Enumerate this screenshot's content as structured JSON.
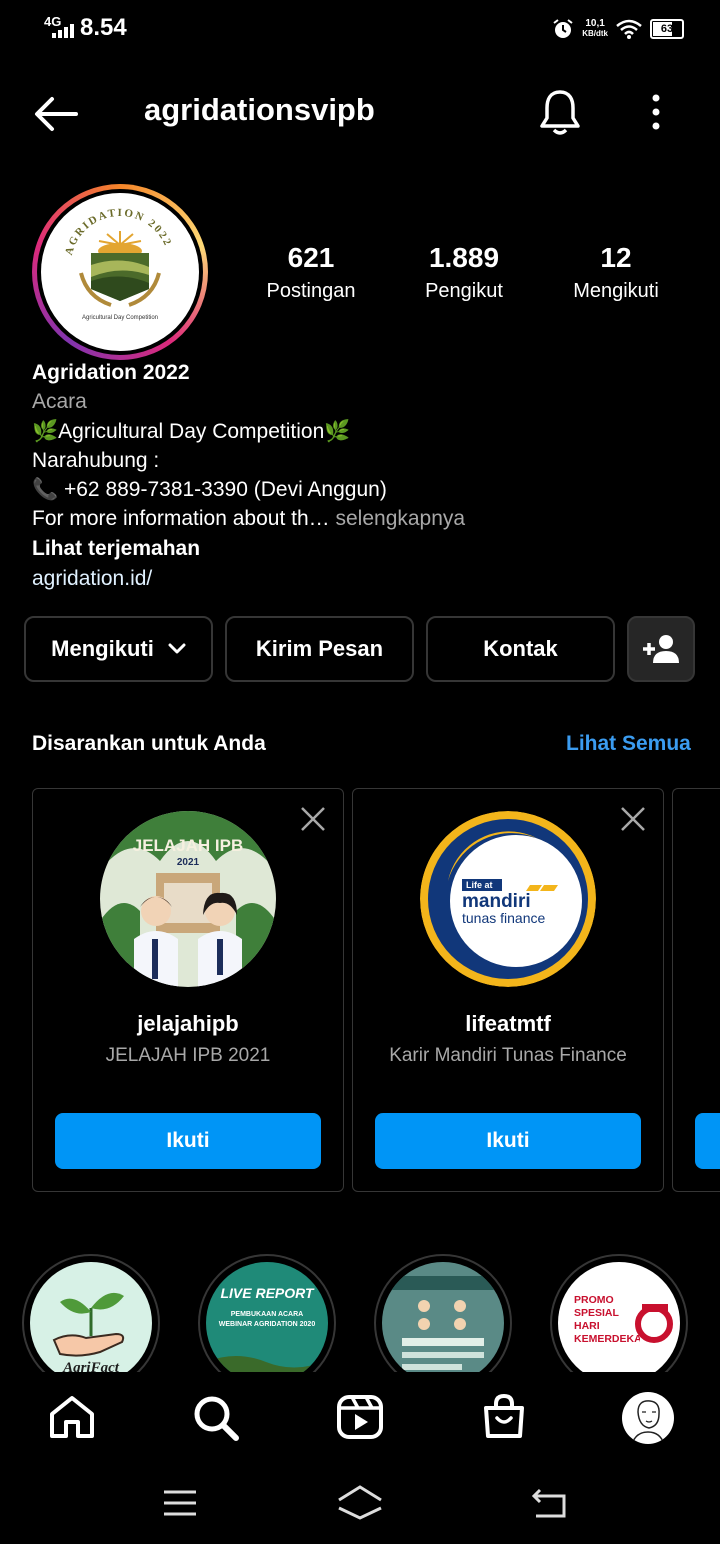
{
  "status_bar": {
    "network": "4G",
    "time": "8.54",
    "net_speed_value": "10,1",
    "net_speed_unit": "KB/dtk",
    "battery": "63"
  },
  "header": {
    "username": "agridationsvipb",
    "icons": [
      "back-arrow-icon",
      "bell-icon",
      "more-vertical-icon"
    ]
  },
  "profile": {
    "avatar_text_top": "AGRIDATION 2022",
    "avatar_text_bottom": "Agricultural Day Competition",
    "stats": [
      {
        "value": "621",
        "label": "Postingan"
      },
      {
        "value": "1.889",
        "label": "Pengikut"
      },
      {
        "value": "12",
        "label": "Mengikuti"
      }
    ],
    "name": "Agridation 2022",
    "category": "Acara",
    "bio_line1": "🌿Agricultural Day Competition🌿",
    "bio_line2": "Narahubung :",
    "bio_line3": "📞 +62 889-7381-3390 (Devi Anggun)",
    "bio_line4": "For more information about th…",
    "more_label": "selengkapnya",
    "translate_label": "Lihat terjemahan",
    "website": "agridation.id/"
  },
  "actions": {
    "following_label": "Mengikuti",
    "message_label": "Kirim Pesan",
    "contact_label": "Kontak"
  },
  "suggestions": {
    "title": "Disarankan untuk Anda",
    "see_all": "Lihat Semua",
    "cards": [
      {
        "username": "jelajahipb",
        "subtitle": "JELAJAH IPB 2021",
        "button": "Ikuti",
        "pic_text": "JELAJAH IPB",
        "pic_year": "2021"
      },
      {
        "username": "lifeatmtf",
        "subtitle": "Karir Mandiri Tunas Finance",
        "button": "Ikuti",
        "pic_text1": "Life at",
        "pic_text2": "mandiri",
        "pic_text3": "tunas finance"
      }
    ]
  },
  "highlights": [
    {
      "text": "AgriFact"
    },
    {
      "text": "LIVE REPORT",
      "subtext": "PEMBUKAAN ACARA WEBINAR AGRIDATION 2020"
    },
    {
      "text": ""
    },
    {
      "text": "PROMO SPESIAL HARI KEMERDEKAAN"
    }
  ],
  "tabbar": {
    "icons": [
      "home-icon",
      "search-icon",
      "reels-icon",
      "shop-icon",
      "profile-avatar"
    ]
  },
  "colors": {
    "background": "#000000",
    "accent_blue": "#0095f6",
    "link_blue": "#3b9cf0",
    "border": "#363636",
    "muted": "#a8a8a8"
  }
}
